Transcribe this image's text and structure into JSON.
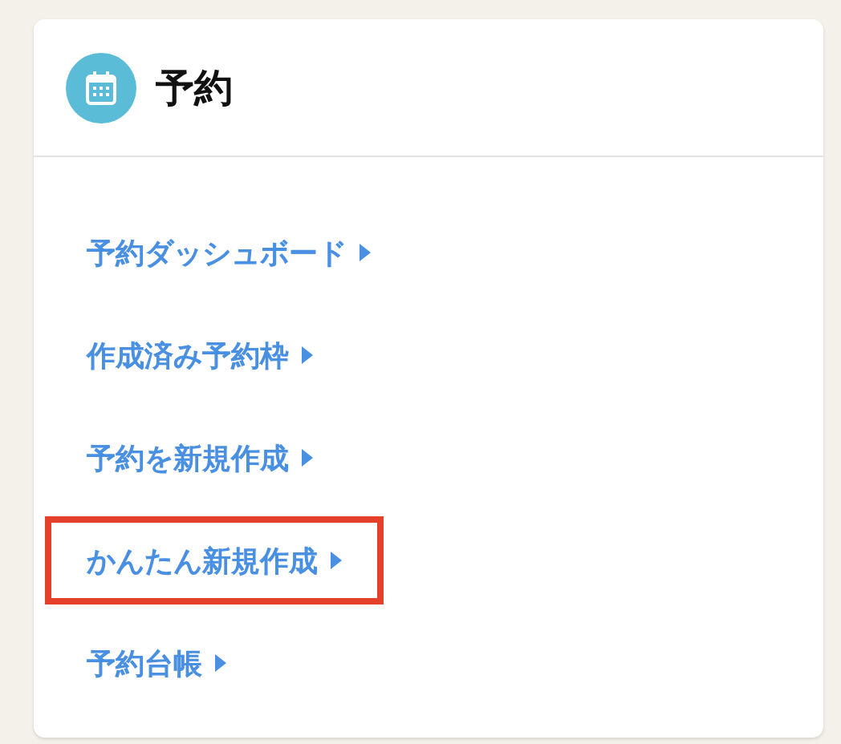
{
  "card": {
    "title": "予約",
    "links": [
      {
        "label": "予約ダッシュボード",
        "highlighted": false
      },
      {
        "label": "作成済み予約枠",
        "highlighted": false
      },
      {
        "label": "予約を新規作成",
        "highlighted": false
      },
      {
        "label": "かんたん新規作成",
        "highlighted": true
      },
      {
        "label": "予約台帳",
        "highlighted": false
      }
    ]
  }
}
